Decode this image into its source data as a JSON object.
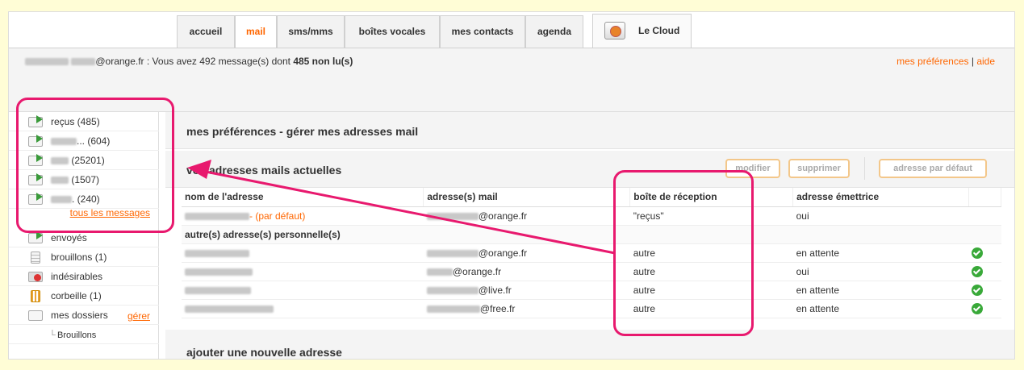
{
  "tabs": {
    "accueil": "accueil",
    "mail": "mail",
    "sms": "sms/mms",
    "voicemail": "boîtes vocales",
    "contacts": "mes contacts",
    "agenda": "agenda",
    "cloud": "Le Cloud"
  },
  "infobar": {
    "status_prefix": "@orange.fr : Vous avez 492 message(s) dont ",
    "unread": "485 non lu(s)",
    "prefs_link": "mes préférences",
    "separator": "|",
    "help_link": "aide"
  },
  "sidebar": {
    "items": [
      {
        "label": "reçus (485)",
        "icon": "inbox-arrow-icon"
      },
      {
        "label": "... (604)",
        "icon": "inbox-arrow-icon"
      },
      {
        "label": "(25201)",
        "icon": "inbox-arrow-icon"
      },
      {
        "label": "(1507)",
        "icon": "inbox-arrow-icon"
      },
      {
        "label": ". (240)",
        "icon": "inbox-arrow-icon"
      }
    ],
    "all_messages": "tous les messages",
    "sent": "envoyés",
    "drafts": "brouillons (1)",
    "spam": "indésirables",
    "trash": "corbeille (1)",
    "folders": "mes dossiers",
    "manage": "gérer",
    "sub_drafts": "Brouillons"
  },
  "main": {
    "title": "mes préférences - gérer mes adresses mail",
    "section_title": "vos adresses mails actuelles",
    "buttons": {
      "modify": "modifier",
      "delete": "supprimer",
      "default": "adresse par défaut"
    },
    "columns": [
      "nom de l'adresse",
      "adresse(s) mail",
      "boîte de réception",
      "adresse émettrice"
    ],
    "default_row": {
      "name_suffix": "- (par défaut)",
      "mail": "@orange.fr",
      "box": "\"reçus\"",
      "sender": "oui"
    },
    "group_label": "autre(s) adresse(s) personnelle(s)",
    "rows": [
      {
        "mail": "@orange.fr",
        "box": "autre",
        "sender": "en attente"
      },
      {
        "mail": "@orange.fr",
        "box": "autre",
        "sender": "oui"
      },
      {
        "mail": "@live.fr",
        "box": "autre",
        "sender": "en attente"
      },
      {
        "mail": "@free.fr",
        "box": "autre",
        "sender": "en attente"
      }
    ],
    "add_title": "ajouter une nouvelle adresse"
  },
  "colors": {
    "accent": "#ff6600",
    "annotation": "#e8196e",
    "background": "#fffdd6",
    "check": "#39a939"
  }
}
